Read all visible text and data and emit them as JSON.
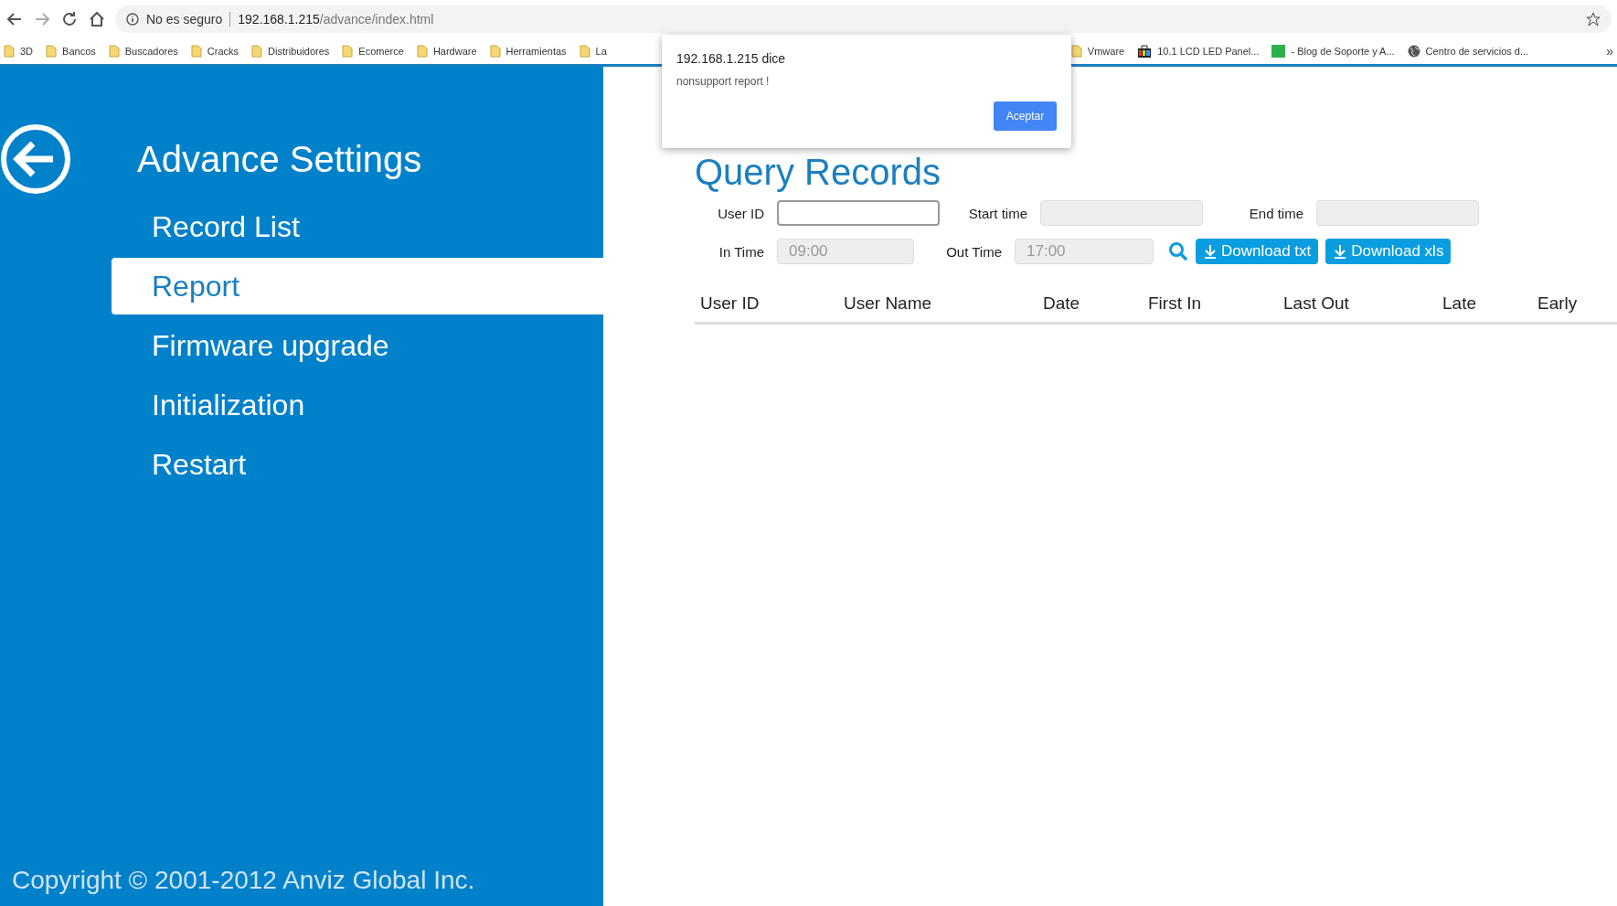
{
  "browser": {
    "security": "No es seguro",
    "url_host": "192.168.1.215",
    "url_path": "/advance/index.html"
  },
  "bookmarks": [
    {
      "kind": "folder",
      "label": "3D"
    },
    {
      "kind": "folder",
      "label": "Bancos"
    },
    {
      "kind": "folder",
      "label": "Buscadores"
    },
    {
      "kind": "folder",
      "label": "Cracks"
    },
    {
      "kind": "folder",
      "label": "Distribuidores"
    },
    {
      "kind": "folder",
      "label": "Ecomerce"
    },
    {
      "kind": "folder",
      "label": "Hardware"
    },
    {
      "kind": "folder",
      "label": "Herramientas"
    },
    {
      "kind": "folder",
      "label": "La"
    },
    {
      "kind": "gap"
    },
    {
      "kind": "folder",
      "label": "Vmware"
    },
    {
      "kind": "bag",
      "label": "10.1 LCD LED Panel..."
    },
    {
      "kind": "tile",
      "label": "- Blog de Soporte y A..."
    },
    {
      "kind": "globe",
      "label": "Centro de servicios d..."
    }
  ],
  "more_bookmarks": "»",
  "sidebar": {
    "title": "Advance Settings",
    "items": [
      {
        "label": "Record List",
        "selected": false
      },
      {
        "label": "Report",
        "selected": true
      },
      {
        "label": "Firmware upgrade",
        "selected": false
      },
      {
        "label": "Initialization",
        "selected": false
      },
      {
        "label": "Restart",
        "selected": false
      }
    ],
    "copyright": "Copyright © 2001-2012 Anviz Global Inc."
  },
  "main": {
    "title": "Query Records",
    "fields_row_1": [
      {
        "label": "User ID",
        "disabled": false
      },
      {
        "label": "Start time",
        "disabled": true
      },
      {
        "label": "End time",
        "disabled": true
      }
    ],
    "fields_row_2": [
      {
        "label": "In Time",
        "value": "09:00",
        "disabled": true
      },
      {
        "label": "Out Time",
        "value": "17:00",
        "disabled": true
      }
    ],
    "buttons": [
      "Download txt",
      "Download xls"
    ],
    "table": {
      "columns": [
        "User ID",
        "User Name",
        "Date",
        "First In",
        "Last Out",
        "Late",
        "Early"
      ]
    }
  },
  "dialog": {
    "title": "192.168.1.215 dice",
    "message": "nonsupport report !",
    "button": "Aceptar"
  }
}
